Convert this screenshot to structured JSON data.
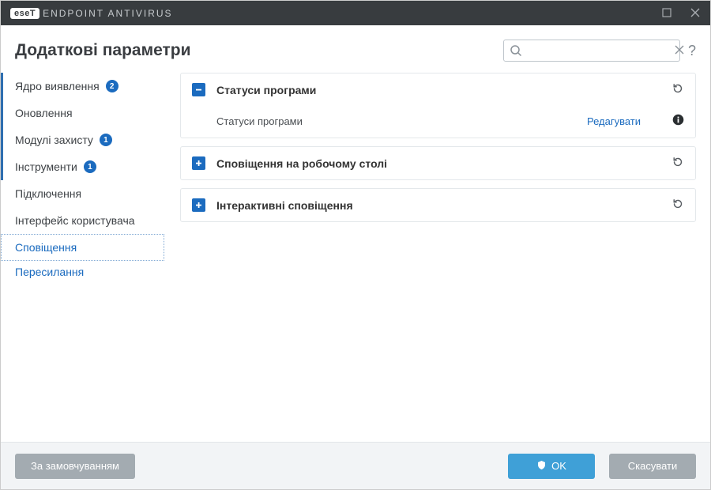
{
  "titlebar": {
    "logo_badge": "eseT",
    "product_name": "ENDPOINT ANTIVIRUS"
  },
  "header": {
    "title": "Додаткові параметри",
    "search_value": "",
    "search_placeholder": ""
  },
  "sidebar": {
    "items": [
      {
        "label": "Ядро виявлення",
        "badge": "2"
      },
      {
        "label": "Оновлення"
      },
      {
        "label": "Модулі захисту",
        "badge": "1"
      },
      {
        "label": "Інструменти",
        "badge": "1"
      },
      {
        "label": "Підключення"
      },
      {
        "label": "Інтерфейс користувача"
      },
      {
        "label": "Сповіщення",
        "children": [
          {
            "label": "Пересилання"
          }
        ]
      }
    ]
  },
  "content": {
    "panels": [
      {
        "title": "Статуси програми",
        "expanded": true,
        "rows": [
          {
            "label": "Статуси програми",
            "action": "Редагувати"
          }
        ]
      },
      {
        "title": "Сповіщення на робочому столі",
        "expanded": false
      },
      {
        "title": "Інтерактивні сповіщення",
        "expanded": false
      }
    ]
  },
  "footer": {
    "default_btn": "За замовчуванням",
    "ok_btn": "OK",
    "cancel_btn": "Скасувати"
  }
}
